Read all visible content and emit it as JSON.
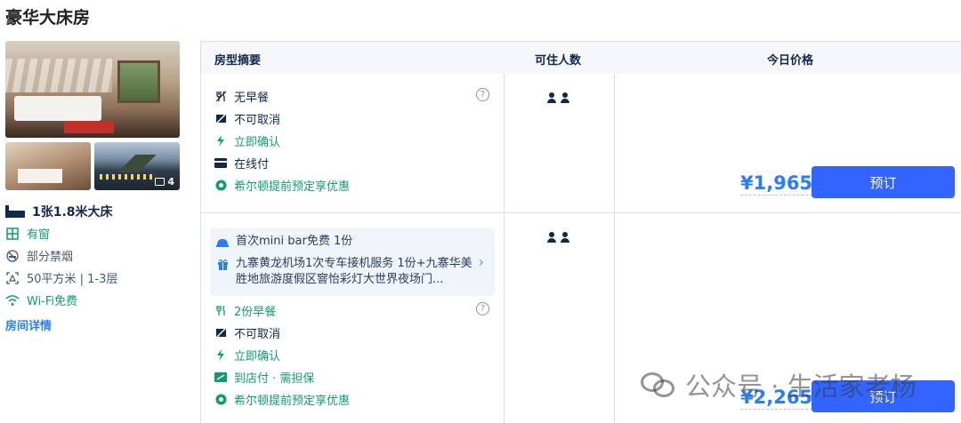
{
  "room": {
    "title": "豪华大床房",
    "photo_count": "4",
    "bed": "1张1.8米大床",
    "facilities": [
      {
        "icon": "window-icon",
        "label": "有窗",
        "color": "#0d9e6e"
      },
      {
        "icon": "no-smoking-icon",
        "label": "部分禁烟",
        "color": "#455873"
      },
      {
        "icon": "area-icon",
        "label": "50平方米 | 1-3层",
        "color": "#455873"
      },
      {
        "icon": "wifi-icon",
        "label": "Wi-Fi免费",
        "color": "#0d9e6e"
      }
    ],
    "detail_link": "房间详情"
  },
  "table": {
    "headers": [
      "房型摘要",
      "可住人数",
      "今日价格"
    ],
    "rows": [
      {
        "policies": [
          {
            "icon": "cutlery-icon",
            "label": "无早餐",
            "green": false
          },
          {
            "icon": "no-cancel-icon",
            "label": "不可取消",
            "green": false
          },
          {
            "icon": "lightning-icon",
            "label": "立即确认",
            "green": true
          },
          {
            "icon": "card-icon",
            "label": "在线付",
            "green": false
          },
          {
            "icon": "hilton-icon",
            "label": "希尔顿提前预定享优惠",
            "green": true
          }
        ],
        "guests": 2,
        "price": "¥1,965",
        "button": "预订"
      },
      {
        "perks": [
          {
            "icon": "minibar-icon",
            "label": "首次mini bar免费 1份"
          },
          {
            "icon": "gift-icon",
            "label": "九寨黄龙机场1次专车接机服务 1份+九寨华美胜地旅游度假区窨怡彩灯大世界夜场门..."
          }
        ],
        "policies": [
          {
            "icon": "cutlery-icon",
            "label": "2份早餐",
            "green": true
          },
          {
            "icon": "no-cancel-icon",
            "label": "不可取消",
            "green": false
          },
          {
            "icon": "lightning-icon",
            "label": "立即确认",
            "green": true
          },
          {
            "icon": "store-pay-icon",
            "label": "到店付 · 需担保",
            "green": true
          },
          {
            "icon": "hilton-icon",
            "label": "希尔顿提前预定享优惠",
            "green": true
          }
        ],
        "guests": 2,
        "price": "¥2,265",
        "button": "预订"
      }
    ]
  },
  "watermark": "公众号 · 生活家老杨",
  "colors": {
    "accent": "#287dfa",
    "button": "#3264ff",
    "green": "#0d9e6e",
    "text": "#0f294d"
  }
}
